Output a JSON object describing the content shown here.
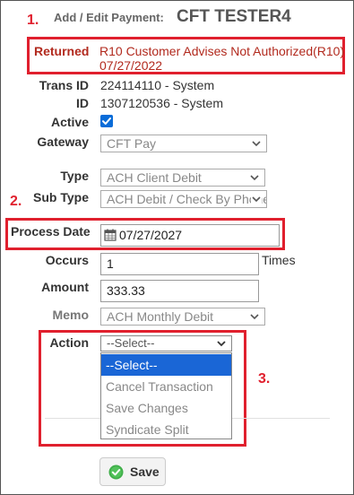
{
  "annotations": {
    "marker1": "1.",
    "marker2": "2.",
    "marker3": "3."
  },
  "header": {
    "prefix": "Add / Edit Payment:",
    "title": "CFT TESTER4"
  },
  "returned": {
    "label": "Returned",
    "reason": "R10 Customer Advises Not Authorized(R10)",
    "date": "07/27/2022"
  },
  "fields": {
    "trans_id_label": "Trans ID",
    "trans_id_value": "224114110 - System",
    "id_label": "ID",
    "id_value": "1307120536 - System",
    "active_label": "Active",
    "active_checked": true,
    "gateway_label": "Gateway",
    "gateway_value": "CFT Pay",
    "type_label": "Type",
    "type_value": "ACH Client Debit",
    "subtype_label": "Sub Type",
    "subtype_value": "ACH Debit / Check By Phone",
    "process_date_label": "Process Date",
    "process_date_value": "07/27/2027",
    "occurs_label": "Occurs",
    "occurs_value": "1",
    "occurs_unit": "Times",
    "amount_label": "Amount",
    "amount_value": "333.33",
    "memo_label": "Memo",
    "memo_value": "ACH Monthly Debit",
    "action_label": "Action",
    "action_value": "--Select--"
  },
  "action_options": [
    "--Select--",
    "Cancel Transaction",
    "Save Changes",
    "Syndicate Split"
  ],
  "save_button": {
    "label": "Save",
    "icon": "check-circle-icon"
  },
  "colors": {
    "annotation_red": "#e0202e",
    "returned_text": "#b22a1e",
    "highlight_blue": "#1a66d6",
    "checkbox_blue": "#0a6cd8",
    "save_icon_green": "#3fae49"
  }
}
